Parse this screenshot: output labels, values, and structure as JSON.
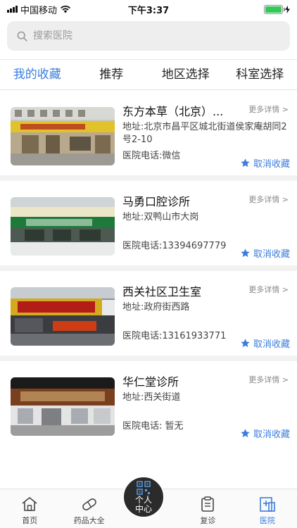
{
  "status_bar": {
    "carrier": "中国移动",
    "time": "下午3:37",
    "battery_level": 1.0
  },
  "search": {
    "placeholder": "搜索医院"
  },
  "tabs": [
    {
      "label": "我的收藏",
      "active": true
    },
    {
      "label": "推荐",
      "active": false
    },
    {
      "label": "地区选择",
      "active": false
    },
    {
      "label": "科室选择",
      "active": false
    }
  ],
  "hospitals": [
    {
      "name": "东方本草（北京）...",
      "more": "更多详情",
      "address": "地址:北京市昌平区城北街道侯家庵胡同2号2-10",
      "phone": "医院电话:微信",
      "action": "取消收藏"
    },
    {
      "name": "马勇口腔诊所",
      "more": "更多详情",
      "address": "地址:双鸭山市大岗",
      "phone": "医院电话:13394697779",
      "action": "取消收藏"
    },
    {
      "name": "西关社区卫生室",
      "more": "更多详情",
      "address": "地址:政府街西路",
      "phone": "医院电话:13161933771",
      "action": "取消收藏"
    },
    {
      "name": "华仁堂诊所",
      "more": "更多详情",
      "address": "地址:西关街道",
      "phone": "医院电话: 暂无",
      "action": "取消收藏"
    }
  ],
  "bottom_nav": [
    {
      "label": "首页",
      "icon": "home-icon"
    },
    {
      "label": "药品大全",
      "icon": "pill-icon"
    },
    {
      "label": "复诊",
      "icon": "clipboard-icon"
    },
    {
      "label": "医院",
      "icon": "hospital-icon",
      "active": true
    }
  ],
  "center_button": {
    "line1": "个人",
    "line2": "中心"
  },
  "colors": {
    "accent": "#3b7ddd",
    "battery": "#34c759"
  }
}
